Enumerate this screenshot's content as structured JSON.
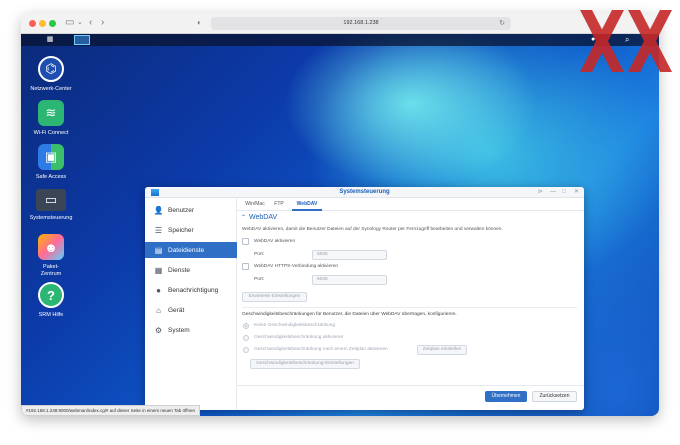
{
  "browser": {
    "url": "192.168.1.238",
    "status_link": "#192.168.1.238:8000/webman/index.cgi# auf dieser Seite in einem neuen Tab öffnen"
  },
  "desktop": {
    "icons": [
      {
        "label": "Netzwerk-Center",
        "icon": "network-center-icon"
      },
      {
        "label": "Wi-Fi Connect",
        "icon": "wifi-icon"
      },
      {
        "label": "Safe Access",
        "icon": "safe-access-icon"
      },
      {
        "label": "Systemsteuerung",
        "icon": "control-panel-icon"
      },
      {
        "label": "Paket-\nZentrum",
        "icon": "package-center-icon"
      },
      {
        "label": "SRM Hilfe",
        "icon": "help-icon"
      }
    ]
  },
  "window": {
    "title": "Systemsteuerung",
    "sidebar": [
      {
        "label": "Benutzer",
        "icon": "user-icon",
        "active": false
      },
      {
        "label": "Speicher",
        "icon": "storage-icon",
        "active": false
      },
      {
        "label": "Dateidienste",
        "icon": "file-services-icon",
        "active": true
      },
      {
        "label": "Dienste",
        "icon": "services-icon",
        "active": false
      },
      {
        "label": "Benachrichtigung",
        "icon": "notification-icon",
        "active": false
      },
      {
        "label": "Gerät",
        "icon": "device-icon",
        "active": false
      },
      {
        "label": "System",
        "icon": "system-gear-icon",
        "active": false
      }
    ],
    "tabs": [
      "Win/Mac",
      "FTP",
      "WebDAV"
    ],
    "active_tab": "WebDAV",
    "section_title": "WebDAV",
    "description": "WebDAV aktivieren, damit die Benutzer Dateien auf der Synology Router per Fernzugriff bearbeiten und verwalten können.",
    "webdav_label": "WebDAV aktivieren",
    "port_label": "Port:",
    "webdav_port": "5005",
    "https_label": "WebDAV HTTPS-Verbindung aktivieren",
    "https_port": "5006",
    "advanced_button": "Erweiterte Einstellungen",
    "speed_intro": "Geschwindigkeitsbeschränkungen für Benutzer, die Dateien über WebDAV übertragen, konfigurieren.",
    "radio_none": "Keine Geschwindigkeitsbeschränkung",
    "radio_enable": "Geschwindigkeitsbeschränkung aktivieren",
    "radio_schedule": "Geschwindigkeitsbeschränkung nach einem Zeitplan aktivieren",
    "schedule_button": "Zeitplan einstellen",
    "speed_settings_button": "Geschwindigkeitsbeschränkung-Einstellungen",
    "apply_button": "Übernehmen",
    "reset_button": "Zurücksetzen"
  },
  "watermark": "XX"
}
